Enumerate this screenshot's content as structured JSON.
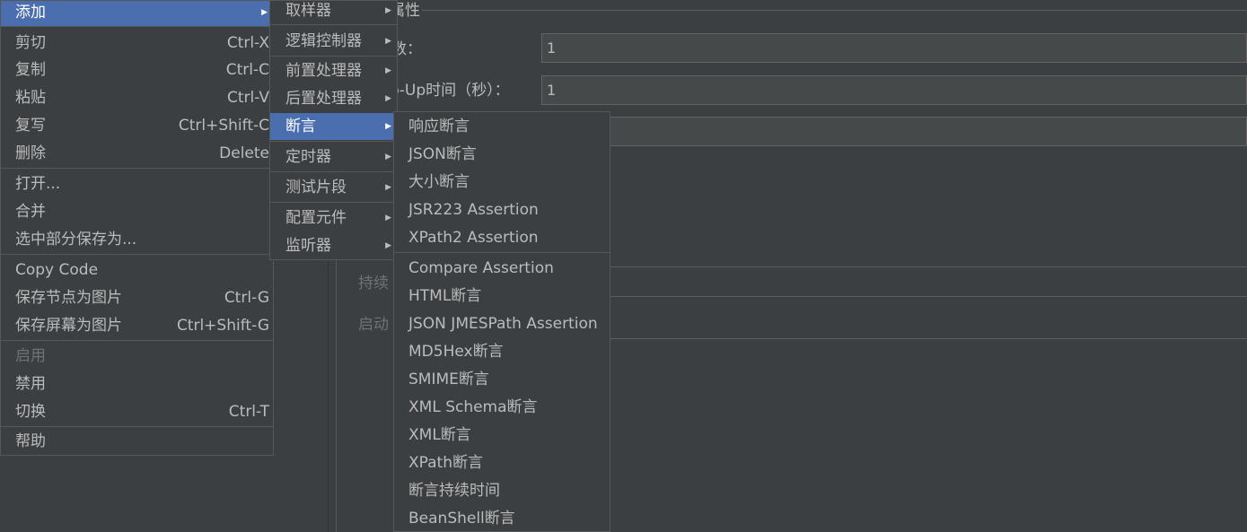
{
  "background_panel": {
    "section_title": "属性",
    "fields": [
      {
        "label": "数：",
        "value": "1"
      },
      {
        "label": "p-Up时间（秒）：",
        "value": "1"
      },
      {
        "label": "",
        "value": ""
      }
    ],
    "dim_labels": [
      "持续",
      "启动"
    ]
  },
  "context_menu": {
    "items": [
      {
        "label": "添加",
        "shortcut": "",
        "submenu": true,
        "selected": true
      },
      {
        "label": "剪切",
        "shortcut": "Ctrl-X"
      },
      {
        "label": "复制",
        "shortcut": "Ctrl-C"
      },
      {
        "label": "粘贴",
        "shortcut": "Ctrl-V"
      },
      {
        "label": "复写",
        "shortcut": "Ctrl+Shift-C"
      },
      {
        "label": "删除",
        "shortcut": "Delete"
      },
      {
        "label": "打开...",
        "shortcut": ""
      },
      {
        "label": "合并",
        "shortcut": ""
      },
      {
        "label": "选中部分保存为...",
        "shortcut": ""
      },
      {
        "label": "Copy Code",
        "shortcut": ""
      },
      {
        "label": "保存节点为图片",
        "shortcut": "Ctrl-G"
      },
      {
        "label": "保存屏幕为图片",
        "shortcut": "Ctrl+Shift-G"
      },
      {
        "label": "启用",
        "shortcut": "",
        "disabled": true
      },
      {
        "label": "禁用",
        "shortcut": ""
      },
      {
        "label": "切换",
        "shortcut": "Ctrl-T"
      },
      {
        "label": "帮助",
        "shortcut": ""
      }
    ]
  },
  "add_submenu": {
    "items": [
      {
        "label": "取样器"
      },
      {
        "label": "逻辑控制器"
      },
      {
        "label": "前置处理器"
      },
      {
        "label": "后置处理器"
      },
      {
        "label": "断言",
        "selected": true
      },
      {
        "label": "定时器"
      },
      {
        "label": "测试片段"
      },
      {
        "label": "配置元件"
      },
      {
        "label": "监听器"
      }
    ]
  },
  "assertion_submenu": {
    "items": [
      {
        "label": "响应断言"
      },
      {
        "label": "JSON断言"
      },
      {
        "label": "大小断言"
      },
      {
        "label": "JSR223 Assertion"
      },
      {
        "label": "XPath2 Assertion"
      },
      {
        "label": "Compare Assertion"
      },
      {
        "label": "HTML断言"
      },
      {
        "label": "JSON JMESPath Assertion"
      },
      {
        "label": "MD5Hex断言"
      },
      {
        "label": "SMIME断言"
      },
      {
        "label": "XML Schema断言"
      },
      {
        "label": "XML断言"
      },
      {
        "label": "XPath断言"
      },
      {
        "label": "断言持续时间"
      },
      {
        "label": "BeanShell断言"
      }
    ]
  },
  "colors": {
    "background": "#3c3f41",
    "selection": "#4b6eaf",
    "text": "#bbbbbb",
    "disabled_text": "#6f7173"
  },
  "icons": {
    "submenu_arrow": "triangle-right-icon"
  }
}
